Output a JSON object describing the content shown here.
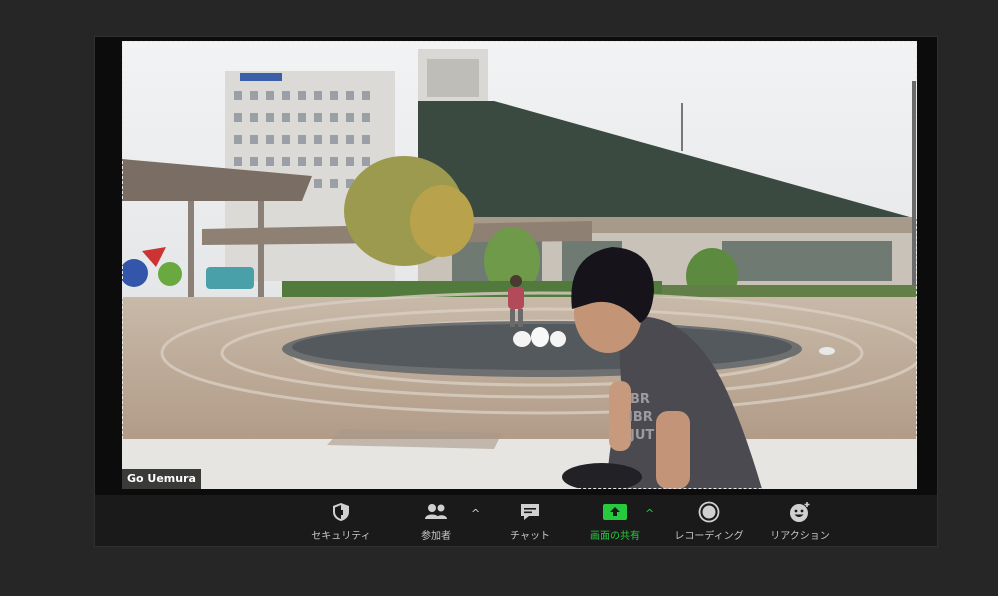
{
  "participant": {
    "name": "Go Uemura"
  },
  "toolbar": {
    "buttons": [
      {
        "id": "security",
        "label": "セキュリティ",
        "icon": "shield-icon"
      },
      {
        "id": "participants",
        "label": "参加者",
        "icon": "participants-icon"
      },
      {
        "id": "chat",
        "label": "チャット",
        "icon": "chat-bubble-icon"
      },
      {
        "id": "share",
        "label": "画面の共有",
        "icon": "share-screen-icon"
      },
      {
        "id": "record",
        "label": "レコーディング",
        "icon": "record-icon"
      },
      {
        "id": "reactions",
        "label": "リアクション",
        "icon": "emoji-icon"
      }
    ],
    "caret_symbol": "^"
  },
  "colors": {
    "share_accent": "#27c93f",
    "toolbar_bg": "#1a1a1a",
    "page_bg": "#262626"
  }
}
